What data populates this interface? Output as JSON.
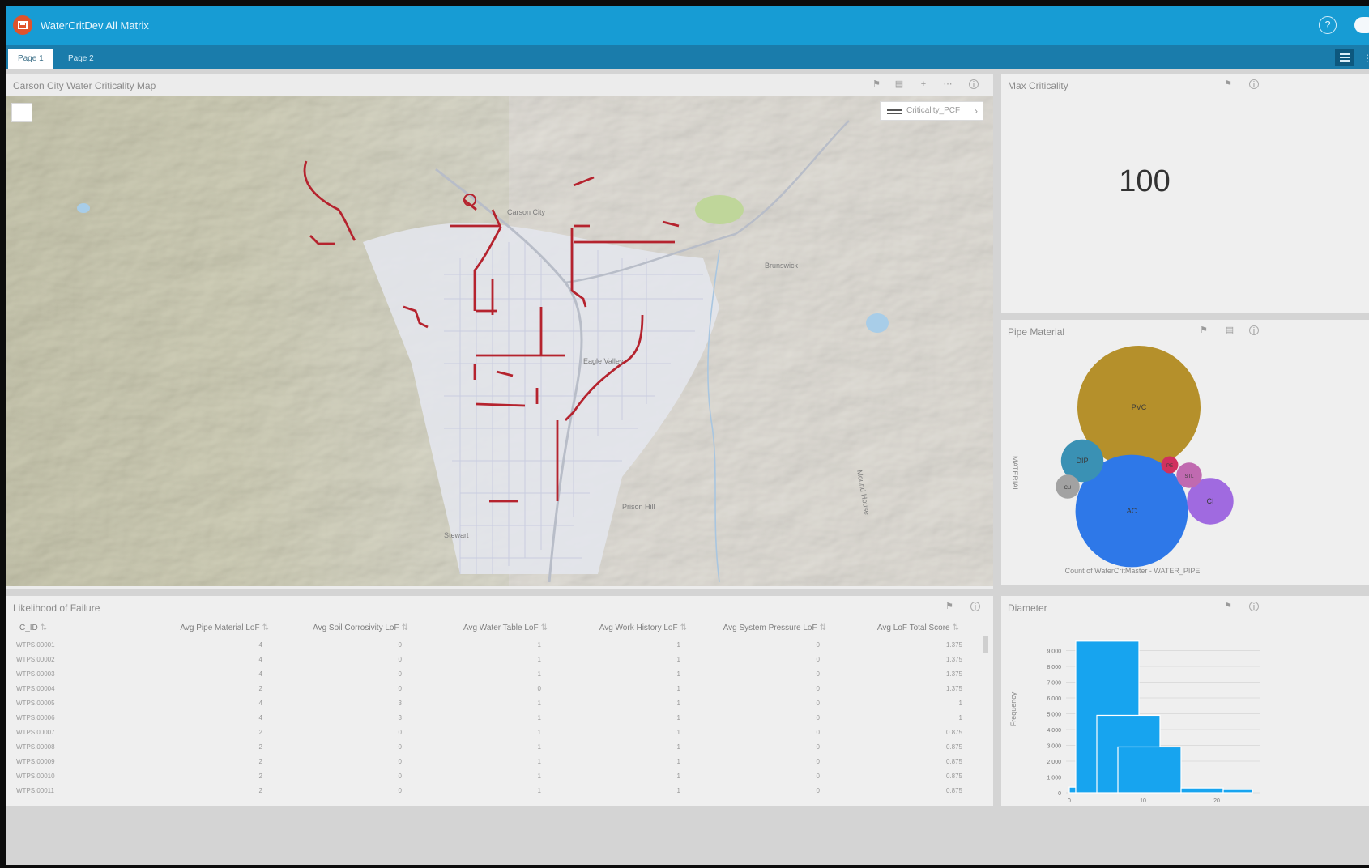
{
  "app": {
    "title": "WaterCritDev All Matrix",
    "help_icon": "question-circle-icon",
    "logo_icon": "app-logo-icon"
  },
  "tabs": [
    {
      "label": "Page 1",
      "active": true
    },
    {
      "label": "Page 2",
      "active": false
    }
  ],
  "map": {
    "title": "Carson City Water Criticality Map",
    "legend_label": "Criticality_PCF",
    "place_labels": [
      "Carson City",
      "Brunswick",
      "Eagle Valley",
      "Stewart",
      "Prison Hill",
      "Mound House"
    ],
    "tools": [
      "bookmark-icon",
      "layers-icon",
      "expand-icon",
      "more-icon",
      "info-icon"
    ]
  },
  "max_criticality": {
    "title": "Max Criticality",
    "value": "100"
  },
  "pipe_material": {
    "title": "Pipe Material",
    "axis_label": "MATERIAL",
    "caption": "Count of WaterCritMaster - WATER_PIPE",
    "bubbles": [
      {
        "label": "PVC",
        "value": 42,
        "color": "#b5902b"
      },
      {
        "label": "AC",
        "value": 35,
        "color": "#2e78e8"
      },
      {
        "label": "DIP",
        "value": 5,
        "color": "#3a91b4"
      },
      {
        "label": "CI",
        "value": 6,
        "color": "#a06ae0"
      },
      {
        "label": "STL",
        "value": 1.8,
        "color": "#c06ab0"
      },
      {
        "label": "CU",
        "value": 1.6,
        "color": "#a2a2a2"
      },
      {
        "label": "PE",
        "value": 0.8,
        "color": "#d0305e"
      }
    ]
  },
  "diameter": {
    "title": "Diameter",
    "chart_data": {
      "type": "bar",
      "ylabel": "Frequency",
      "ylim": [
        0,
        10000
      ],
      "yticks": [
        "0",
        "1,000",
        "2,000",
        "3,000",
        "4,000",
        "5,000",
        "6,000",
        "7,000",
        "8,000",
        "9,000"
      ],
      "xticks": [
        "0",
        "10",
        "20"
      ],
      "bins": [
        {
          "x": "0-1",
          "value": 350
        },
        {
          "x": "1-4",
          "value": 9600
        },
        {
          "x": "4-8",
          "value": 4900
        },
        {
          "x": "8-12",
          "value": 2900
        },
        {
          "x": "12-16",
          "value": 300
        },
        {
          "x": "16-20",
          "value": 200
        }
      ]
    }
  },
  "lof": {
    "title": "Likelihood of Failure",
    "columns": [
      "C_ID",
      "Avg Pipe Material LoF",
      "Avg Soil Corrosivity LoF",
      "Avg Water Table LoF",
      "Avg Work History LoF",
      "Avg System Pressure LoF",
      "Avg LoF Total Score"
    ],
    "rows": [
      [
        "WTPS.00001",
        "4",
        "0",
        "1",
        "1",
        "0",
        "1.375"
      ],
      [
        "WTPS.00002",
        "4",
        "0",
        "1",
        "1",
        "0",
        "1.375"
      ],
      [
        "WTPS.00003",
        "4",
        "0",
        "1",
        "1",
        "0",
        "1.375"
      ],
      [
        "WTPS.00004",
        "2",
        "0",
        "0",
        "1",
        "0",
        "1.375"
      ],
      [
        "WTPS.00005",
        "4",
        "3",
        "1",
        "1",
        "0",
        "1"
      ],
      [
        "WTPS.00006",
        "4",
        "3",
        "1",
        "1",
        "0",
        "1"
      ],
      [
        "WTPS.00007",
        "2",
        "0",
        "1",
        "1",
        "0",
        "0.875"
      ],
      [
        "WTPS.00008",
        "2",
        "0",
        "1",
        "1",
        "0",
        "0.875"
      ],
      [
        "WTPS.00009",
        "2",
        "0",
        "1",
        "1",
        "0",
        "0.875"
      ],
      [
        "WTPS.00010",
        "2",
        "0",
        "1",
        "1",
        "0",
        "0.875"
      ],
      [
        "WTPS.00011",
        "2",
        "0",
        "1",
        "1",
        "0",
        "0.875"
      ]
    ]
  }
}
